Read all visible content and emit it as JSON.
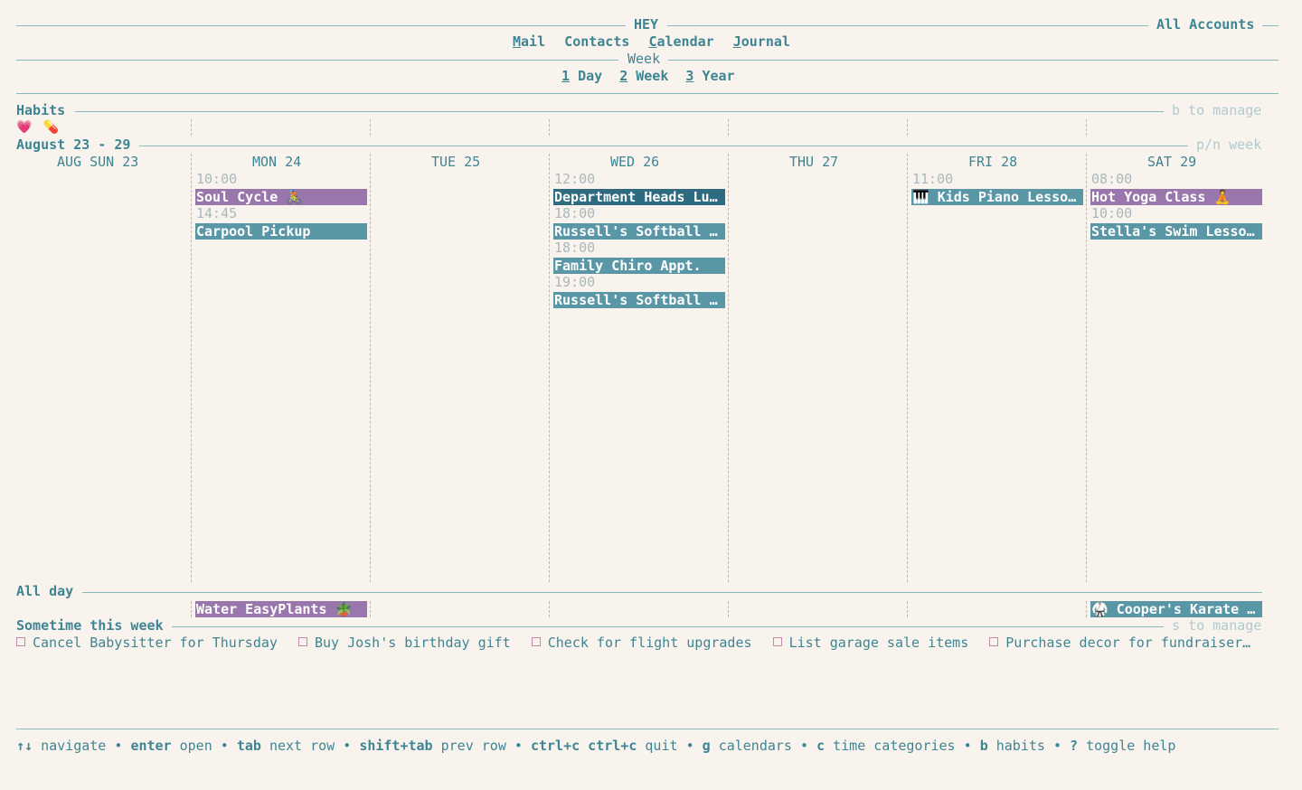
{
  "header": {
    "app_title": "HEY",
    "accounts": "All Accounts",
    "nav": [
      {
        "hot": "M",
        "rest": "ail"
      },
      {
        "hot": "C",
        "rest": "ontacts",
        "plain": true
      },
      {
        "hot": "C",
        "rest": "alendar"
      },
      {
        "hot": "J",
        "rest": "ournal"
      }
    ],
    "view_title": "Week",
    "views": [
      {
        "key": "1",
        "label": "Day"
      },
      {
        "key": "2",
        "label": "Week"
      },
      {
        "key": "3",
        "label": "Year"
      }
    ]
  },
  "habits": {
    "title": "Habits",
    "hint": "b to manage",
    "icons": [
      "💗",
      "💊"
    ]
  },
  "week": {
    "title": "August 23 - 29",
    "hint": "p/n week",
    "days": [
      "AUG SUN 23",
      "MON 24",
      "TUE 25",
      "WED 26",
      "THU 27",
      "FRI 28",
      "SAT 29"
    ]
  },
  "events": {
    "mon": [
      {
        "time": "10:00",
        "title": "Soul Cycle 🚴",
        "color": "purple"
      },
      {
        "time": "14:45",
        "title": "Carpool Pickup",
        "color": "teal"
      }
    ],
    "wed": [
      {
        "time": "12:00",
        "title": "Department Heads Lun…",
        "color": "dark"
      },
      {
        "time": "18:00",
        "title": "Russell's Softball L…",
        "color": "teal"
      },
      {
        "time": "18:00",
        "title": "Family Chiro Appt.",
        "color": "teal"
      },
      {
        "time": "19:00",
        "title": "Russell's Softball L…",
        "color": "teal"
      }
    ],
    "fri": [
      {
        "time": "11:00",
        "title": "🎹 Kids Piano Lessons",
        "color": "teal"
      }
    ],
    "sat": [
      {
        "time": "08:00",
        "title": "Hot Yoga Class 🧘",
        "color": "purple"
      },
      {
        "time": "10:00",
        "title": "Stella's Swim Lesson…",
        "color": "teal"
      }
    ]
  },
  "allday": {
    "title": "All day",
    "mon": "Water EasyPlants 🪴",
    "sat": "🥋 Cooper's Karate T…"
  },
  "sometime": {
    "title": "Sometime this week",
    "hint": "s to manage",
    "todos": [
      "Cancel Babysitter for Thursday",
      "Buy Josh's birthday gift",
      "Check for flight upgrades",
      "List garage sale items",
      "Purchase decor for fundraiser…"
    ]
  },
  "footer": [
    {
      "key": "↑↓",
      "label": "navigate"
    },
    {
      "key": "enter",
      "label": "open"
    },
    {
      "key": "tab",
      "label": "next row"
    },
    {
      "key": "shift+tab",
      "label": "prev row"
    },
    {
      "key": "ctrl+c ctrl+c",
      "label": "quit"
    },
    {
      "key": "g",
      "label": "calendars"
    },
    {
      "key": "c",
      "label": "time categories"
    },
    {
      "key": "b",
      "label": "habits"
    },
    {
      "key": "?",
      "label": "toggle help"
    }
  ]
}
